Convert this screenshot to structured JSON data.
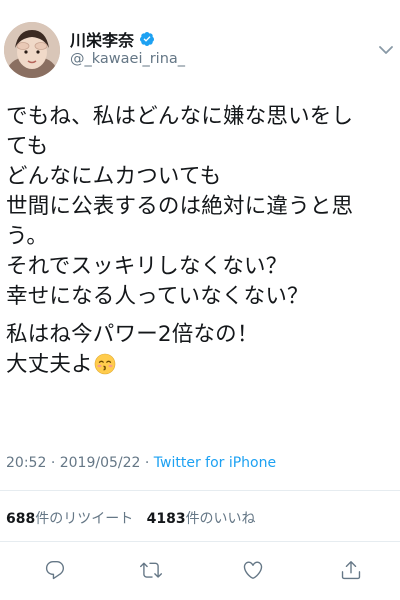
{
  "tweet": {
    "author": {
      "display_name": "川栄李奈",
      "handle": "@_kawaei_rina_",
      "verified": true
    },
    "text_lines_1": [
      "でもね、私はどんなに嫌な思いをし",
      "ても",
      "どんなにムカついても",
      "世間に公表するのは絶対に違うと思",
      "う。",
      "それでスッキリしなくない？",
      "幸せになる人っていなくない？"
    ],
    "text_lines_2": [
      "私はね今パワー2倍なの！",
      "大丈夫よ"
    ],
    "emoji": "kissing-face-emoji",
    "time": "20:52",
    "separator": "·",
    "date": "2019/05/22",
    "source": "Twitter for iPhone",
    "retweet_count": "688",
    "retweet_label": "件のリツイート",
    "like_count": "4183",
    "like_label": "件のいいね"
  },
  "actions": [
    "reply-icon",
    "retweet-icon",
    "like-icon",
    "share-icon"
  ],
  "colors": {
    "accent": "#1da1f2",
    "text": "#14171a",
    "muted": "#657786",
    "divider": "#e6ecf0"
  }
}
